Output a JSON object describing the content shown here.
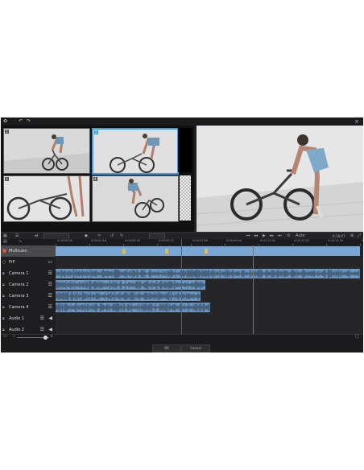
{
  "toolbar_ruler": {
    "timecodes": [
      "0:00:00:00",
      "0:00:01:16",
      "0:00:03:20",
      "0:00:05:12",
      "0:00:07:08",
      "0:00:09:04",
      "0:00:11:00",
      "0:00:12:22",
      "0:00:14:18",
      "0:00:16:14"
    ]
  },
  "preview": {
    "timecode": "0:18:07",
    "zoom": "Auto"
  },
  "tracks": [
    {
      "label": "Multicam",
      "kind": "multicam"
    },
    {
      "label": "PIP",
      "kind": "pip"
    },
    {
      "label": "Camera 1",
      "kind": "video"
    },
    {
      "label": "Camera 2",
      "kind": "video"
    },
    {
      "label": "Camera 3",
      "kind": "video"
    },
    {
      "label": "Camera 4",
      "kind": "video"
    },
    {
      "label": "Audio 1",
      "kind": "audio"
    },
    {
      "label": "Audio 2",
      "kind": "audio"
    }
  ],
  "cameras": [
    {
      "num": "1"
    },
    {
      "num": "2"
    },
    {
      "num": "3"
    },
    {
      "num": "4"
    }
  ],
  "buttons": {
    "ok": "OK",
    "cancel": "Cancel"
  },
  "colors": {
    "accent": "#3d9be0",
    "clip": "#6a97c4",
    "playhead": "#c0373a",
    "record": "#e0533f"
  }
}
